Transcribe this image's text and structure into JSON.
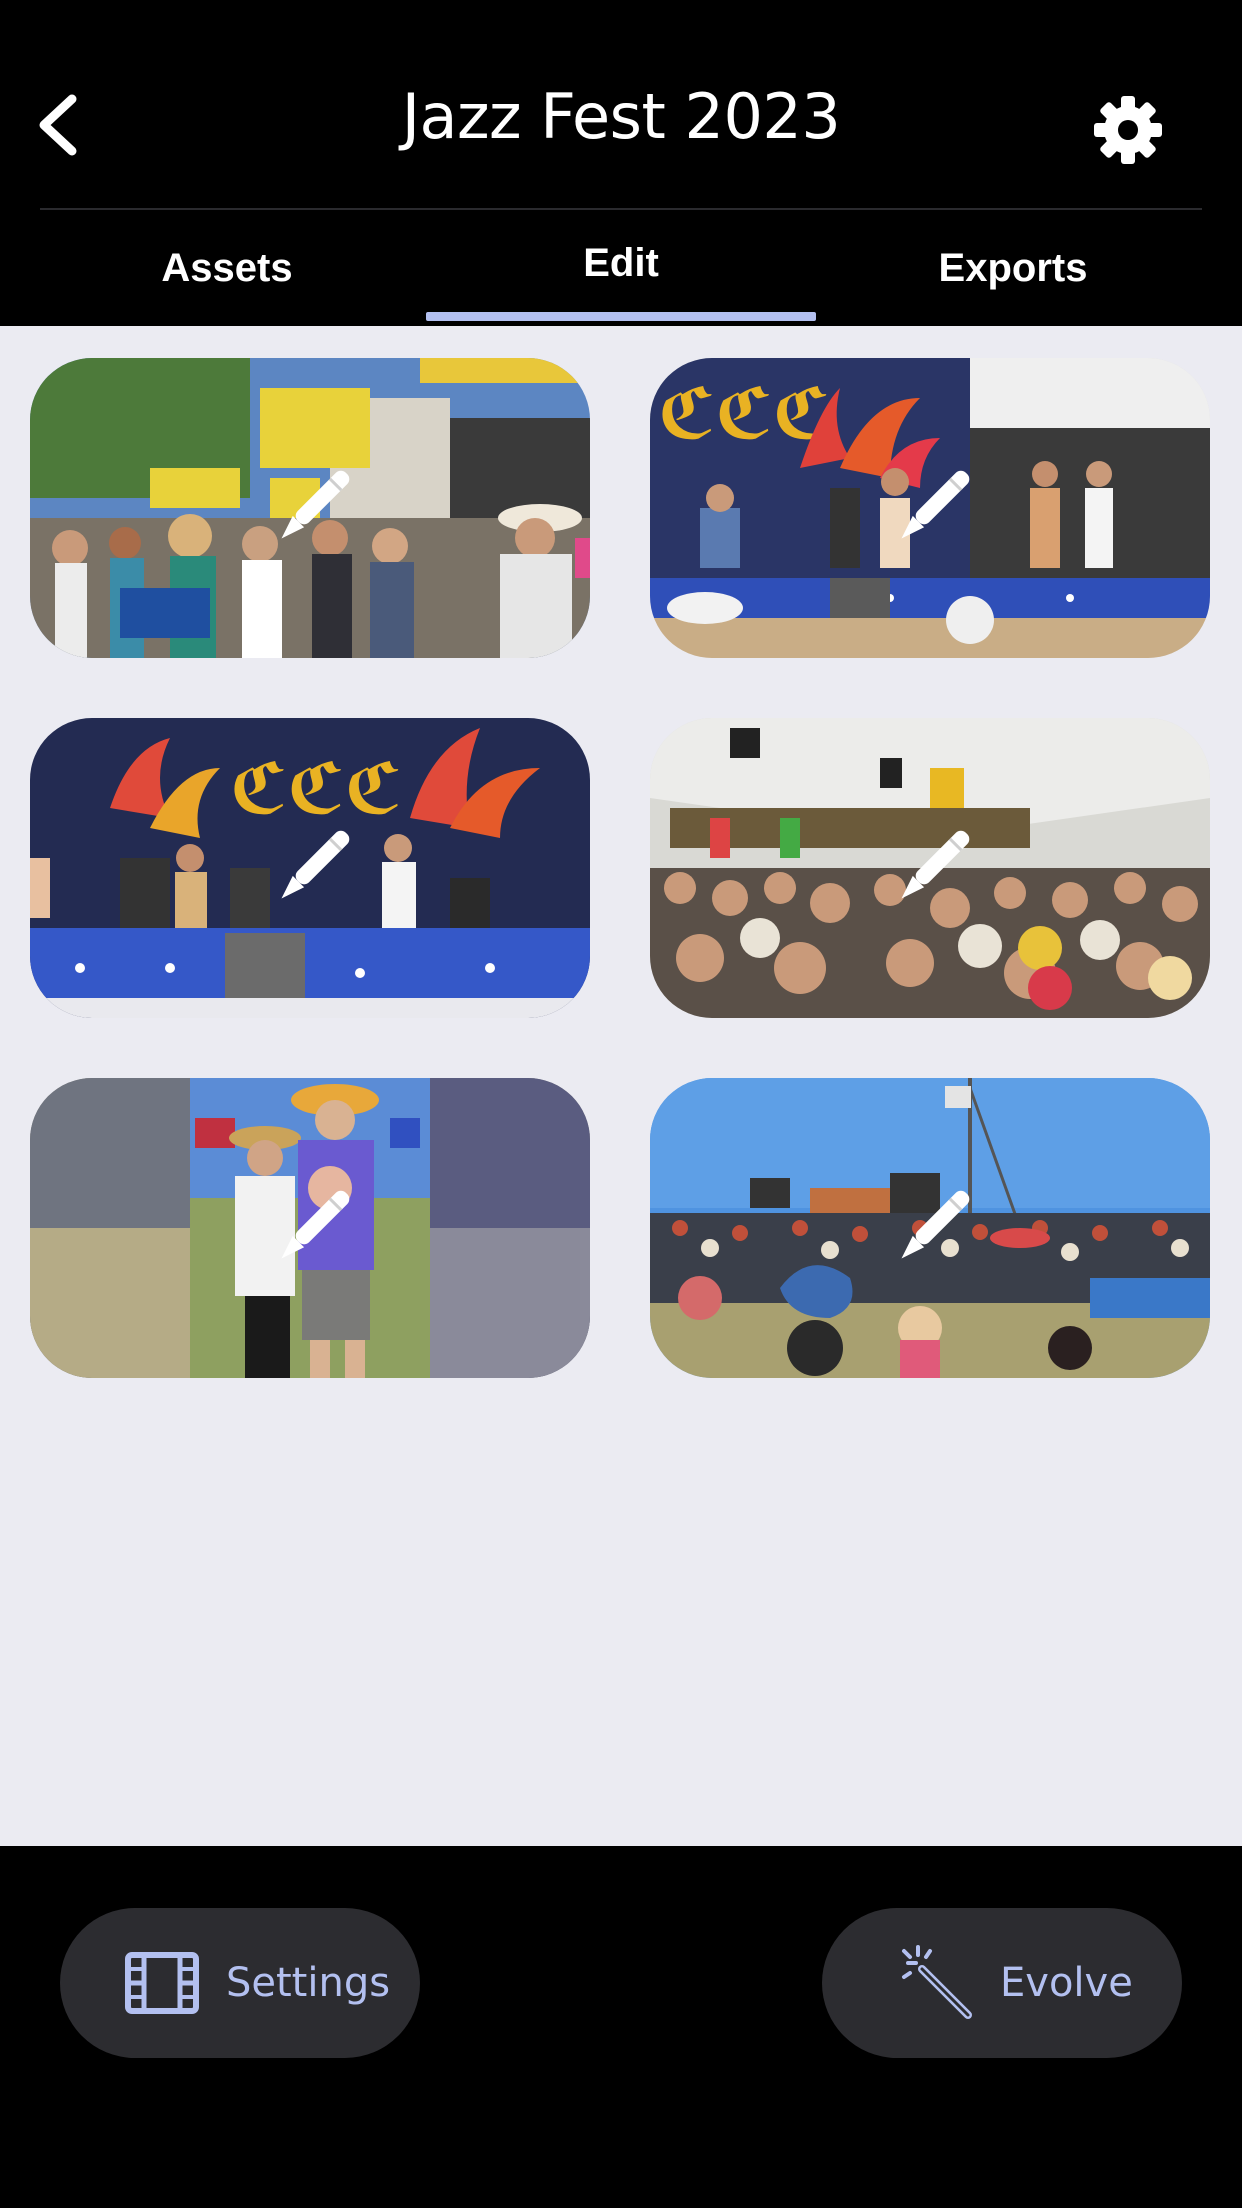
{
  "header": {
    "title": "Jazz Fest 2023",
    "back_icon": "chevron-left-icon",
    "settings_icon": "gear-icon"
  },
  "tabs": [
    {
      "label": "Assets",
      "selected": false
    },
    {
      "label": "Edit",
      "selected": true
    },
    {
      "label": "Exports",
      "selected": false
    }
  ],
  "clips": [
    {
      "scene": "festival entrance crowd with yellow signs",
      "icon": "pencil-icon"
    },
    {
      "scene": "band playing on stage with blue skirt",
      "icon": "pencil-icon"
    },
    {
      "scene": "stage with band and colorful banner",
      "icon": "pencil-icon"
    },
    {
      "scene": "crowd under white tent",
      "icon": "pencil-icon"
    },
    {
      "scene": "couple posing in hats on lawn",
      "icon": "pencil-icon"
    },
    {
      "scene": "large outdoor crowd at main stage",
      "icon": "pencil-icon"
    }
  ],
  "bottom_bar": {
    "settings_label": "Settings",
    "settings_icon": "film-icon",
    "evolve_label": "Evolve",
    "evolve_icon": "magic-wand-icon"
  },
  "colors": {
    "accent": "#b3c0f0",
    "background": "#ebebf2",
    "bar": "#000000",
    "pill": "#2c2c30"
  }
}
